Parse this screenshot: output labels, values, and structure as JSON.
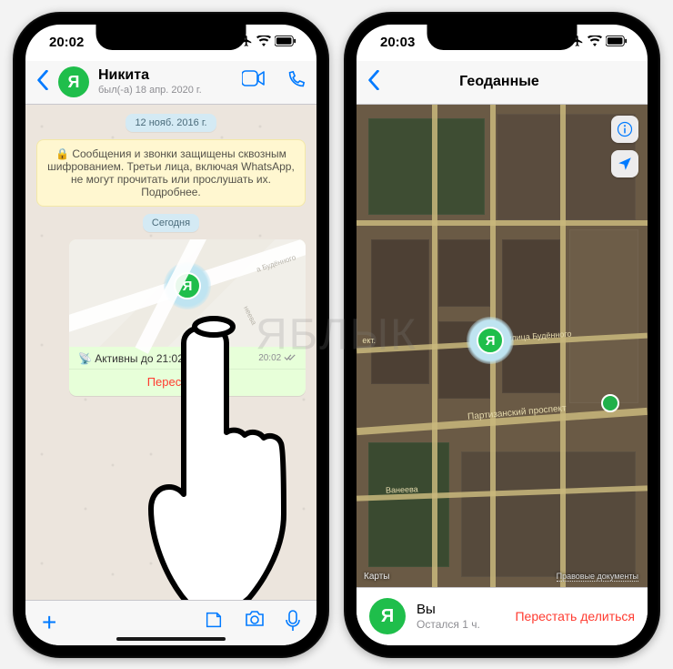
{
  "watermark": "ЯБЛЫК",
  "left": {
    "status": {
      "time": "20:02"
    },
    "header": {
      "avatar_letter": "Я",
      "name": "Никита",
      "last_seen": "был(-а) 18 апр. 2020 г."
    },
    "chat": {
      "date_old": "12 нояб. 2016 г.",
      "encryption_notice": "🔒 Сообщения и звонки защищены сквозным шифрованием. Третьи лица, включая WhatsApp, не могут прочитать или прослушать их. Подробнее.",
      "date_today": "Сегодня",
      "location_card": {
        "avatar_letter": "Я",
        "street1": "а Будённого",
        "street2": "неева",
        "active_until": "Активны до 21:02",
        "active_icon": "📡",
        "sent_time": "20:02",
        "stop_sharing": "Перестать дел"
      }
    },
    "composer": {
      "plus": "+"
    }
  },
  "right": {
    "status": {
      "time": "20:03"
    },
    "header": {
      "title": "Геоданные"
    },
    "map": {
      "center_avatar_letter": "Я",
      "roads": {
        "budyonnogo": "улица Будённого",
        "partizansky": "Партизанский проспект",
        "vaneeva": "Ванеева",
        "ekt": "ект."
      },
      "attribution": "Карты",
      "legal": "Правовые документы"
    },
    "bottom": {
      "avatar_letter": "Я",
      "primary": "Вы",
      "secondary": "Остался 1 ч.",
      "stop": "Перестать делиться"
    }
  }
}
